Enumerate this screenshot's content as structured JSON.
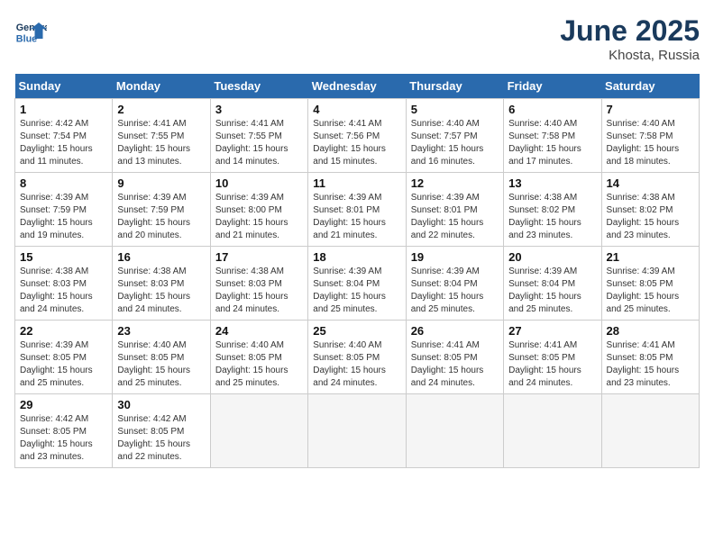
{
  "header": {
    "logo_line1": "General",
    "logo_line2": "Blue",
    "title": "June 2025",
    "subtitle": "Khosta, Russia"
  },
  "days_of_week": [
    "Sunday",
    "Monday",
    "Tuesday",
    "Wednesday",
    "Thursday",
    "Friday",
    "Saturday"
  ],
  "weeks": [
    [
      {
        "day": 1,
        "info": "Sunrise: 4:42 AM\nSunset: 7:54 PM\nDaylight: 15 hours\nand 11 minutes."
      },
      {
        "day": 2,
        "info": "Sunrise: 4:41 AM\nSunset: 7:55 PM\nDaylight: 15 hours\nand 13 minutes."
      },
      {
        "day": 3,
        "info": "Sunrise: 4:41 AM\nSunset: 7:55 PM\nDaylight: 15 hours\nand 14 minutes."
      },
      {
        "day": 4,
        "info": "Sunrise: 4:41 AM\nSunset: 7:56 PM\nDaylight: 15 hours\nand 15 minutes."
      },
      {
        "day": 5,
        "info": "Sunrise: 4:40 AM\nSunset: 7:57 PM\nDaylight: 15 hours\nand 16 minutes."
      },
      {
        "day": 6,
        "info": "Sunrise: 4:40 AM\nSunset: 7:58 PM\nDaylight: 15 hours\nand 17 minutes."
      },
      {
        "day": 7,
        "info": "Sunrise: 4:40 AM\nSunset: 7:58 PM\nDaylight: 15 hours\nand 18 minutes."
      }
    ],
    [
      {
        "day": 8,
        "info": "Sunrise: 4:39 AM\nSunset: 7:59 PM\nDaylight: 15 hours\nand 19 minutes."
      },
      {
        "day": 9,
        "info": "Sunrise: 4:39 AM\nSunset: 7:59 PM\nDaylight: 15 hours\nand 20 minutes."
      },
      {
        "day": 10,
        "info": "Sunrise: 4:39 AM\nSunset: 8:00 PM\nDaylight: 15 hours\nand 21 minutes."
      },
      {
        "day": 11,
        "info": "Sunrise: 4:39 AM\nSunset: 8:01 PM\nDaylight: 15 hours\nand 21 minutes."
      },
      {
        "day": 12,
        "info": "Sunrise: 4:39 AM\nSunset: 8:01 PM\nDaylight: 15 hours\nand 22 minutes."
      },
      {
        "day": 13,
        "info": "Sunrise: 4:38 AM\nSunset: 8:02 PM\nDaylight: 15 hours\nand 23 minutes."
      },
      {
        "day": 14,
        "info": "Sunrise: 4:38 AM\nSunset: 8:02 PM\nDaylight: 15 hours\nand 23 minutes."
      }
    ],
    [
      {
        "day": 15,
        "info": "Sunrise: 4:38 AM\nSunset: 8:03 PM\nDaylight: 15 hours\nand 24 minutes."
      },
      {
        "day": 16,
        "info": "Sunrise: 4:38 AM\nSunset: 8:03 PM\nDaylight: 15 hours\nand 24 minutes."
      },
      {
        "day": 17,
        "info": "Sunrise: 4:38 AM\nSunset: 8:03 PM\nDaylight: 15 hours\nand 24 minutes."
      },
      {
        "day": 18,
        "info": "Sunrise: 4:39 AM\nSunset: 8:04 PM\nDaylight: 15 hours\nand 25 minutes."
      },
      {
        "day": 19,
        "info": "Sunrise: 4:39 AM\nSunset: 8:04 PM\nDaylight: 15 hours\nand 25 minutes."
      },
      {
        "day": 20,
        "info": "Sunrise: 4:39 AM\nSunset: 8:04 PM\nDaylight: 15 hours\nand 25 minutes."
      },
      {
        "day": 21,
        "info": "Sunrise: 4:39 AM\nSunset: 8:05 PM\nDaylight: 15 hours\nand 25 minutes."
      }
    ],
    [
      {
        "day": 22,
        "info": "Sunrise: 4:39 AM\nSunset: 8:05 PM\nDaylight: 15 hours\nand 25 minutes."
      },
      {
        "day": 23,
        "info": "Sunrise: 4:40 AM\nSunset: 8:05 PM\nDaylight: 15 hours\nand 25 minutes."
      },
      {
        "day": 24,
        "info": "Sunrise: 4:40 AM\nSunset: 8:05 PM\nDaylight: 15 hours\nand 25 minutes."
      },
      {
        "day": 25,
        "info": "Sunrise: 4:40 AM\nSunset: 8:05 PM\nDaylight: 15 hours\nand 24 minutes."
      },
      {
        "day": 26,
        "info": "Sunrise: 4:41 AM\nSunset: 8:05 PM\nDaylight: 15 hours\nand 24 minutes."
      },
      {
        "day": 27,
        "info": "Sunrise: 4:41 AM\nSunset: 8:05 PM\nDaylight: 15 hours\nand 24 minutes."
      },
      {
        "day": 28,
        "info": "Sunrise: 4:41 AM\nSunset: 8:05 PM\nDaylight: 15 hours\nand 23 minutes."
      }
    ],
    [
      {
        "day": 29,
        "info": "Sunrise: 4:42 AM\nSunset: 8:05 PM\nDaylight: 15 hours\nand 23 minutes."
      },
      {
        "day": 30,
        "info": "Sunrise: 4:42 AM\nSunset: 8:05 PM\nDaylight: 15 hours\nand 22 minutes."
      },
      null,
      null,
      null,
      null,
      null
    ]
  ]
}
